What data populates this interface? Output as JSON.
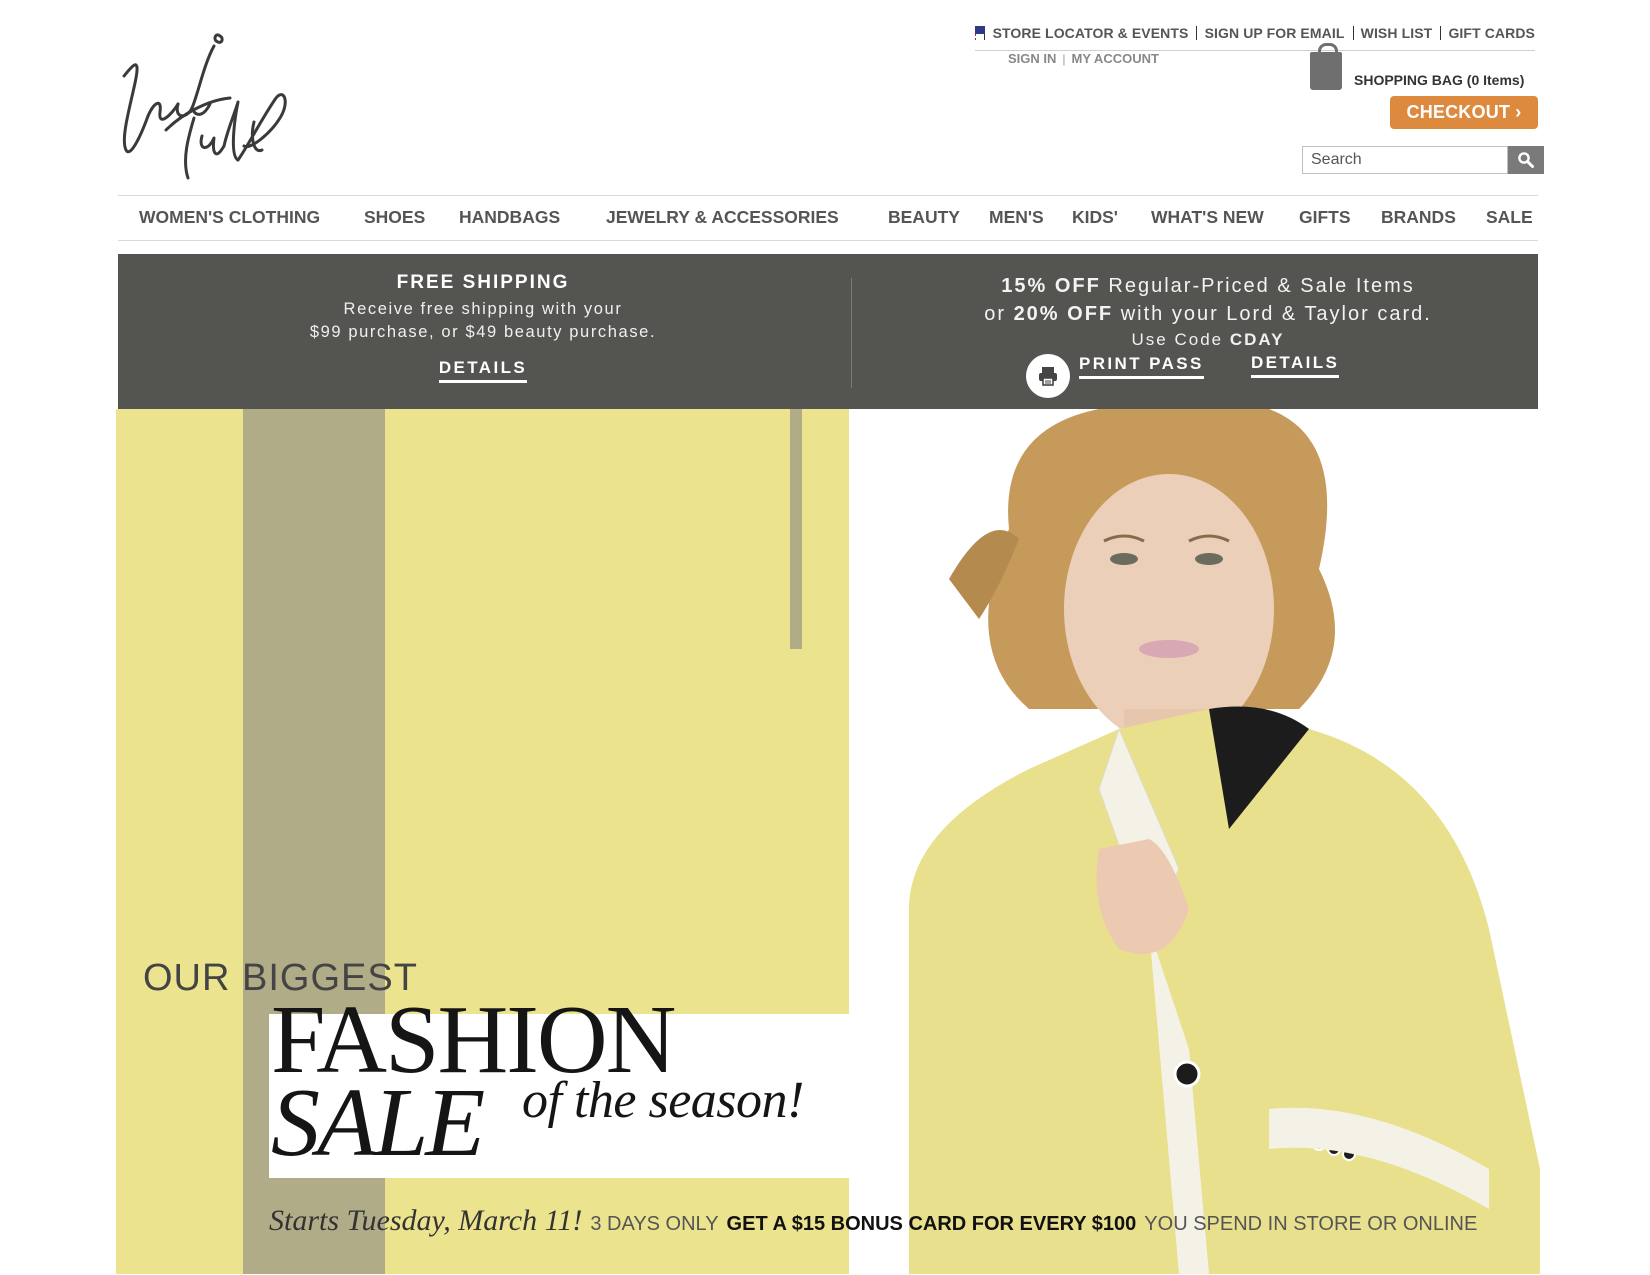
{
  "brand": {
    "logo_alt": "Lord & Taylor"
  },
  "utility_nav": {
    "flag_icon": "us-flag-icon",
    "links": [
      "STORE LOCATOR & EVENTS",
      "SIGN UP FOR EMAIL",
      "WISH LIST",
      "GIFT CARDS"
    ],
    "sign_in": "SIGN IN",
    "my_account": "MY ACCOUNT"
  },
  "cart": {
    "label": "SHOPPING BAG (0 Items)",
    "checkout": "CHECKOUT ›",
    "icon": "shopping-bag-icon"
  },
  "search": {
    "placeholder": "Search",
    "icon": "magnifier-icon"
  },
  "main_nav": {
    "items": [
      "WOMEN'S CLOTHING",
      "SHOES",
      "HANDBAGS",
      "JEWELRY & ACCESSORIES",
      "BEAUTY",
      "MEN'S",
      "KIDS'",
      "WHAT'S NEW",
      "GIFTS",
      "BRANDS",
      "SALE"
    ]
  },
  "promo": {
    "shipping": {
      "heading": "FREE SHIPPING",
      "line1": "Receive free shipping with your",
      "line2": "$99 purchase, or $49 beauty purchase.",
      "details": "DETAILS"
    },
    "discount": {
      "off15": "15% OFF",
      "line1_rest": "Regular-Priced & Sale Items",
      "or": "or",
      "off20": "20% OFF",
      "line2_rest": "with your Lord & Taylor card.",
      "use_code": "Use Code",
      "code": "CDAY",
      "print_pass": "PRINT PASS",
      "details": "DETAILS",
      "print_icon": "printer-icon"
    }
  },
  "hero": {
    "our_biggest": "OUR BIGGEST",
    "fashion": "FASHION",
    "sale": "SALE",
    "of_the_season": "of the season!",
    "starts": "Starts Tuesday, March 11!",
    "days_only": "3 DAYS ONLY",
    "bonus": "GET A $15 BONUS CARD FOR EVERY $100",
    "spend": "YOU SPEND IN STORE OR ONLINE",
    "colors": {
      "yellow": "#ece38e",
      "taupe": "#b0ac88",
      "jacket": "#e8e08c"
    }
  }
}
